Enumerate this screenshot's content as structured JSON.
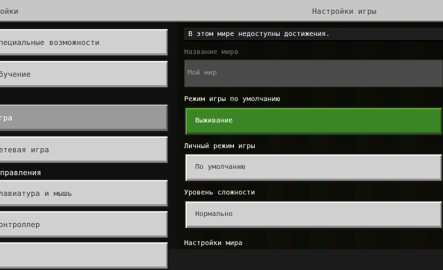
{
  "header": {
    "left_title": "ойки",
    "right_title": "Настройки игры"
  },
  "sidebar": {
    "items": [
      {
        "label": "пециальные возможности"
      },
      {
        "label": "бучение"
      },
      {
        "label": "гра",
        "active": true
      },
      {
        "label": "етевая игра"
      },
      {
        "label": "лавиатура и мышь"
      },
      {
        "label": "онтроллер"
      }
    ],
    "section_header": "правления"
  },
  "main": {
    "notice": "В этом мире недоступны достижения.",
    "world_name_label": "Название мира",
    "world_name_value": "Мой мир",
    "game_mode_label": "Режим игры по умолчанию",
    "game_mode_value": "Выживание",
    "personal_mode_label": "Личный режим игры",
    "personal_mode_value": "По умолчанию",
    "difficulty_label": "Уровень сложности",
    "difficulty_value": "Нормально",
    "world_settings_label": "Настройки мира"
  },
  "colors": {
    "selected_green": "#3c8527",
    "button_gray": "#d0d0d0",
    "active_sidebar": "#9a9a9a"
  }
}
